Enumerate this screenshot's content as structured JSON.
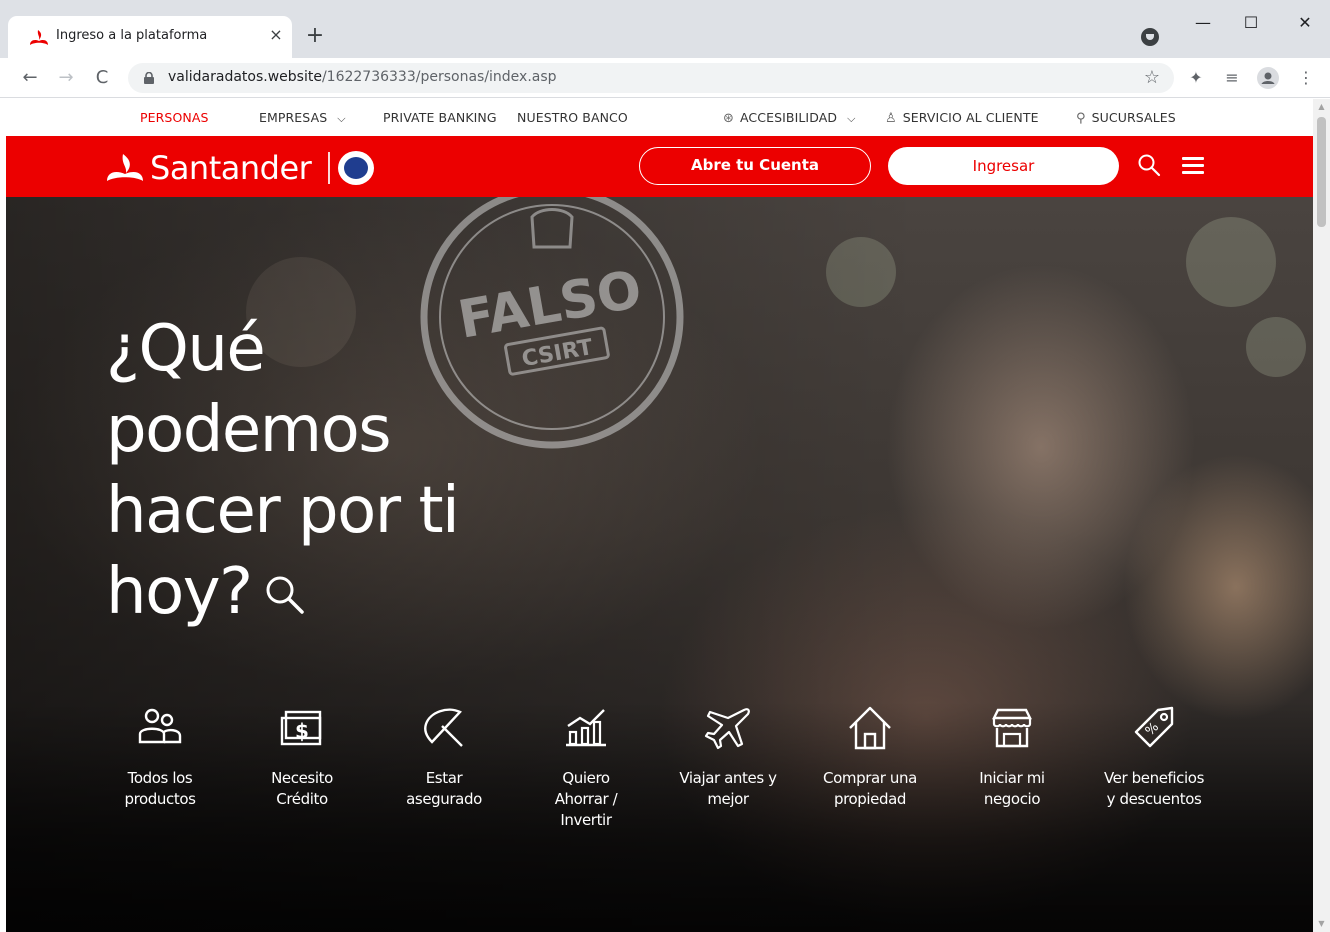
{
  "browser": {
    "tab_title": "Ingreso a la plataforma",
    "tab_close": "×",
    "new_tab": "+",
    "url_host": "validaradatos.website",
    "url_path": "/1622736333/personas/index.asp",
    "window_controls": {
      "minimize": "—",
      "maximize": "☐",
      "close": "✕"
    }
  },
  "topnav": {
    "personas": "PERSONAS",
    "empresas": "EMPRESAS",
    "private_banking": "PRIVATE BANKING",
    "nuestro_banco": "NUESTRO BANCO",
    "accesibilidad": "ACCESIBILIDAD",
    "servicio_cliente": "SERVICIO AL CLIENTE",
    "sucursales": "SUCURSALES"
  },
  "header": {
    "brand": "Santander",
    "open_account": "Abre tu Cuenta",
    "login": "Ingresar",
    "brand_color": "#ec0000"
  },
  "hero": {
    "title_lines": [
      "¿Qué",
      "podemos",
      "hacer por ti",
      "hoy?"
    ],
    "stamp_text": "FALSO",
    "stamp_sub": "CSIRT"
  },
  "quick_links": [
    {
      "label_1": "Todos los",
      "label_2": "productos",
      "icon": "people-icon"
    },
    {
      "label_1": "Necesito",
      "label_2": "Crédito",
      "icon": "money-icon"
    },
    {
      "label_1": "Estar",
      "label_2": "asegurado",
      "icon": "umbrella-icon"
    },
    {
      "label_1": "Quiero",
      "label_2": "Ahorrar /",
      "label_3": "Invertir",
      "icon": "chart-icon"
    },
    {
      "label_1": "Viajar antes y",
      "label_2": "mejor",
      "icon": "plane-icon"
    },
    {
      "label_1": "Comprar una",
      "label_2": "propiedad",
      "icon": "house-icon"
    },
    {
      "label_1": "Iniciar mi",
      "label_2": "negocio",
      "icon": "store-icon"
    },
    {
      "label_1": "Ver beneficios",
      "label_2": "y descuentos",
      "icon": "tag-icon"
    }
  ]
}
